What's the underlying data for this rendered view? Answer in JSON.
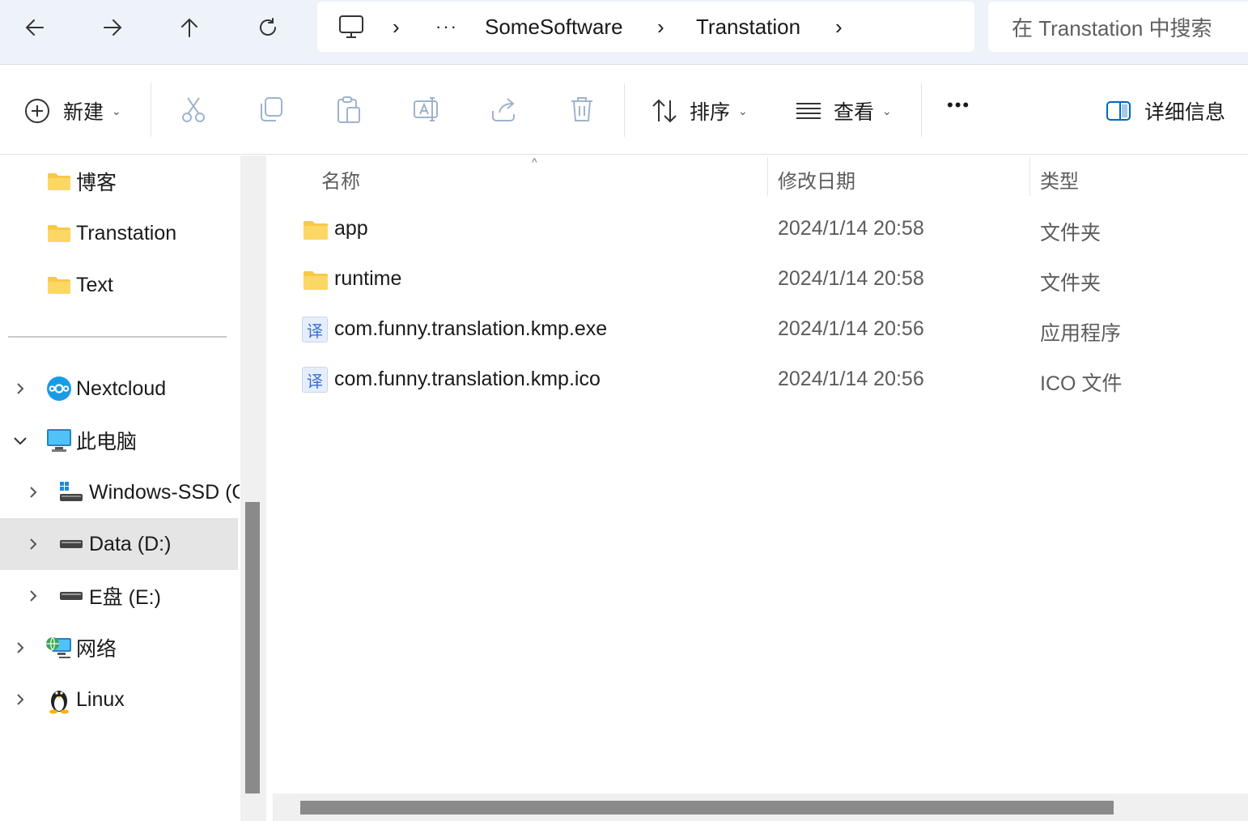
{
  "nav": {
    "back_icon": "arrow-left-icon",
    "forward_icon": "arrow-right-icon",
    "up_icon": "arrow-up-icon",
    "refresh_icon": "refresh-icon"
  },
  "address": {
    "computer_icon": "monitor-icon",
    "sep1": "›",
    "ellipsis": "···",
    "crumb1": "SomeSoftware",
    "sep2": "›",
    "crumb2": "Transtation",
    "sep3": "›"
  },
  "search": {
    "placeholder": "在 Transtation 中搜索"
  },
  "toolbar": {
    "new_label": "新建",
    "sort_label": "排序",
    "view_label": "查看",
    "more_label": "•••",
    "details_label": "详细信息",
    "caret": "⌄"
  },
  "sidebar": {
    "items": [
      {
        "label": "博客",
        "icon": "folder-icon"
      },
      {
        "label": "Transtation",
        "icon": "folder-icon"
      },
      {
        "label": "Text",
        "icon": "folder-icon"
      },
      {
        "label": "Nextcloud",
        "icon": "nextcloud-icon"
      },
      {
        "label": "此电脑",
        "icon": "computer-icon"
      },
      {
        "label": "Windows-SSD (C:)",
        "icon": "system-drive-icon"
      },
      {
        "label": "Data (D:)",
        "icon": "drive-icon",
        "selected": true
      },
      {
        "label": "E盘 (E:)",
        "icon": "drive-icon"
      },
      {
        "label": "网络",
        "icon": "network-icon"
      },
      {
        "label": "Linux",
        "icon": "linux-penguin-icon"
      }
    ]
  },
  "columns": {
    "name": "名称",
    "modified": "修改日期",
    "type": "类型",
    "sort_indicator": "^"
  },
  "files": [
    {
      "name": "app",
      "modified": "2024/1/14 20:58",
      "type": "文件夹",
      "icon": "folder-icon"
    },
    {
      "name": "runtime",
      "modified": "2024/1/14 20:58",
      "type": "文件夹",
      "icon": "folder-icon"
    },
    {
      "name": "com.funny.translation.kmp.exe",
      "modified": "2024/1/14 20:56",
      "type": "应用程序",
      "icon": "translate-app-icon",
      "glyph": "译"
    },
    {
      "name": "com.funny.translation.kmp.ico",
      "modified": "2024/1/14 20:56",
      "type": "ICO 文件",
      "icon": "translate-app-icon",
      "glyph": "译"
    }
  ],
  "colors": {
    "accent": "#0067c0",
    "folder": "#f8c945",
    "selected_bg": "#e5e5e5",
    "topbar_bg": "#eef3f9"
  }
}
